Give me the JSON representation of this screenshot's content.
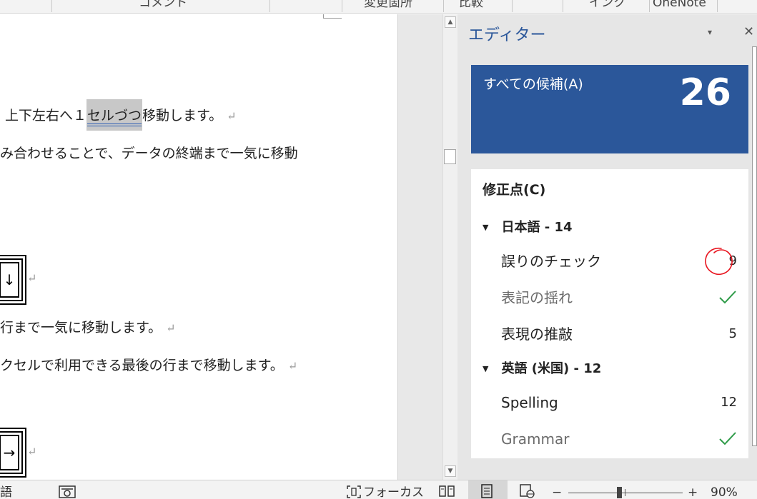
{
  "ribbon": {
    "groups": [
      {
        "label": "コメント"
      },
      {
        "label": "変更箇所"
      },
      {
        "label": "比較"
      },
      {
        "label": "インク"
      },
      {
        "label": "OneNote"
      }
    ]
  },
  "document": {
    "line1": {
      "before": "上下左右へ１",
      "highlight": "セルづつ",
      "after": "移動します。"
    },
    "line2": "み合わせることで、データの終端まで一気に移動",
    "key1": "↓",
    "line3": "行まで一気に移動します。",
    "line4": "クセルで利用できる最後の行まで移動します。",
    "key2": "→",
    "pilcrow": "↵"
  },
  "editor": {
    "title": "エディター",
    "menu_icon": "▾",
    "close_icon": "✕",
    "score": {
      "label": "すべての候補(A)",
      "value": "26"
    },
    "corrections_title": "修正点(C)",
    "groups": [
      {
        "heading": "日本語 - 14",
        "items": [
          {
            "label": "誤りのチェック",
            "count": "9"
          },
          {
            "label": "表記の揺れ",
            "status": "check"
          },
          {
            "label": "表現の推敲",
            "count": "5"
          }
        ]
      },
      {
        "heading": "英語 (米国) - 12",
        "items": [
          {
            "label": "Spelling",
            "count": "12"
          },
          {
            "label": "Grammar",
            "status": "check"
          }
        ]
      }
    ],
    "accent_color": "#2b579a",
    "check_color": "#2e9b48",
    "annotation_color": "#e8141e"
  },
  "statusbar": {
    "language": "語",
    "focus_label": "フォーカス",
    "zoom_minus": "−",
    "zoom_plus": "+",
    "zoom_level": "90%"
  }
}
